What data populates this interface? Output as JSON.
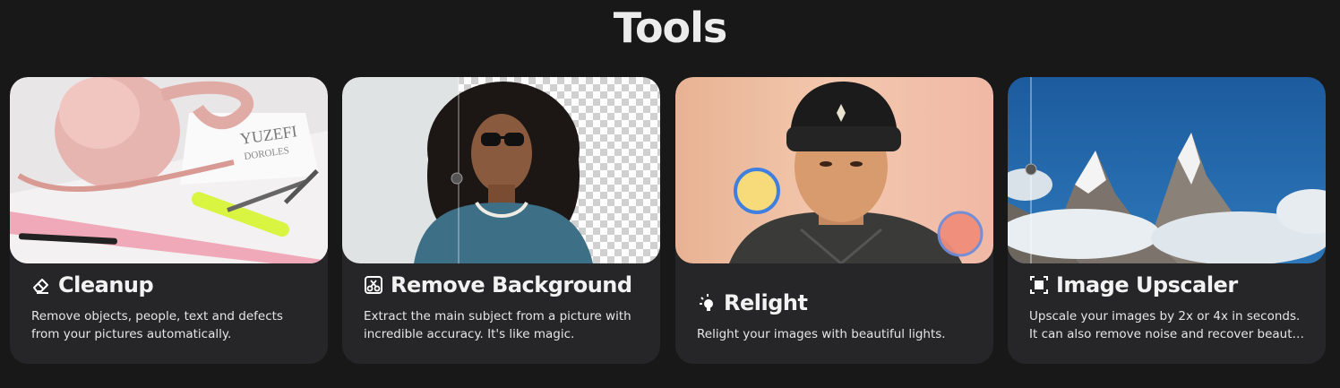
{
  "page": {
    "title": "Tools"
  },
  "tools": [
    {
      "name": "Cleanup",
      "icon": "eraser-icon",
      "lines": [
        "Remove objects, people, text and defects",
        "from your pictures automatically."
      ]
    },
    {
      "name": "Remove Background",
      "icon": "scissors-icon",
      "lines": [
        "Extract the main subject from a picture with",
        "incredible accuracy. It's like magic."
      ]
    },
    {
      "name": "Relight",
      "icon": "lightbulb-icon",
      "lines": [
        "Relight your images with beautiful lights."
      ]
    },
    {
      "name": "Image Upscaler",
      "icon": "upscale-icon",
      "lines": [
        "Upscale your images by 2x or 4x in seconds.",
        "It can also remove noise and recover beautif..."
      ]
    }
  ]
}
